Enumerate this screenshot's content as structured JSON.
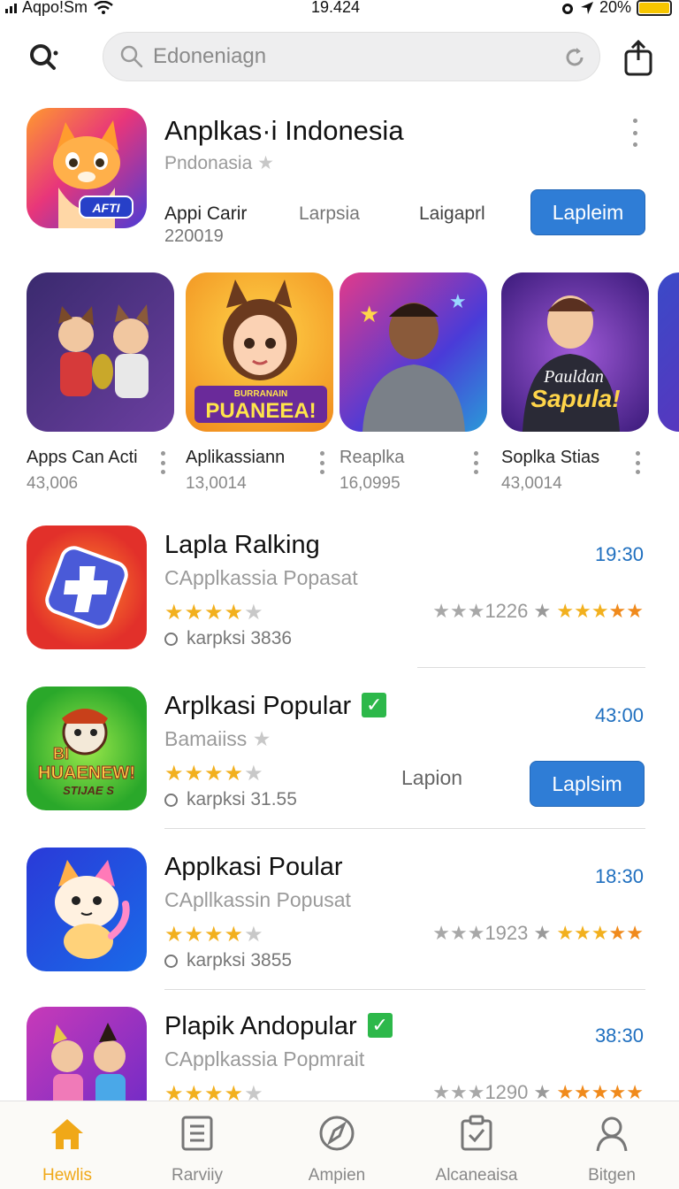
{
  "status": {
    "carrier": "Aqpo!Sm",
    "time": "19.424",
    "battery": "20%"
  },
  "search": {
    "placeholder": "Edoneniagn"
  },
  "featured": {
    "title": "Anplkas·i Indonesia",
    "subtitle": "Pndonasia",
    "meta_label": "Appi Carir",
    "meta_value": "220019",
    "label_2": "Larpsia",
    "label_3": "Laigaprl",
    "button": "Lapleim"
  },
  "carousel": [
    {
      "name": "Apps Can Acti",
      "count": "43,006"
    },
    {
      "name": "Aplikassiann",
      "count": "13,0014"
    },
    {
      "name": "Reaplka",
      "count": "16,0995"
    },
    {
      "name": "Soplka Stias",
      "count": "43,0014"
    }
  ],
  "art_texts": {
    "afti": "AFTI",
    "puaneea_top": "BURRANAIN",
    "puaneea": "PUANEEA!",
    "pauldan": "Pauldan",
    "sapula": "Sapula!",
    "huaenew_top": "BI",
    "huaenew": "HUAENEW!",
    "stijae": "STIJAE S"
  },
  "list": [
    {
      "title": "Lapla Ralking",
      "subtitle": "CApplkassia Popasat",
      "meta": "karpksi  3836",
      "time": "19:30",
      "right_count": "1226"
    },
    {
      "title": "Arplkasi Popular",
      "subtitle": "Bamaiiss",
      "meta": "karpksi  31.55",
      "time": "43:00",
      "action_label": "Lapion",
      "button": "Laplsim"
    },
    {
      "title": "Applkasi Poular",
      "subtitle": "CApllkassin Popusat",
      "meta": "karpksi  3855",
      "time": "18:30",
      "right_count": "1923"
    },
    {
      "title": "Plapik Andopular",
      "subtitle": "CApplkassia Popmrait",
      "meta": "",
      "time": "38:30",
      "right_count": "1290"
    }
  ],
  "nav": [
    {
      "label": "Hewlis",
      "icon": "home-icon"
    },
    {
      "label": "Rarviiy",
      "icon": "document-icon"
    },
    {
      "label": "Ampien",
      "icon": "compass-icon"
    },
    {
      "label": "Alcaneaisa",
      "icon": "clipboard-icon"
    },
    {
      "label": "Bitgen",
      "icon": "person-icon"
    }
  ],
  "colors": {
    "accent": "#2f7dd6",
    "time": "#1f6fbf",
    "star": "#f2b01e",
    "nav_active": "#f0a818",
    "check": "#2db84a"
  }
}
